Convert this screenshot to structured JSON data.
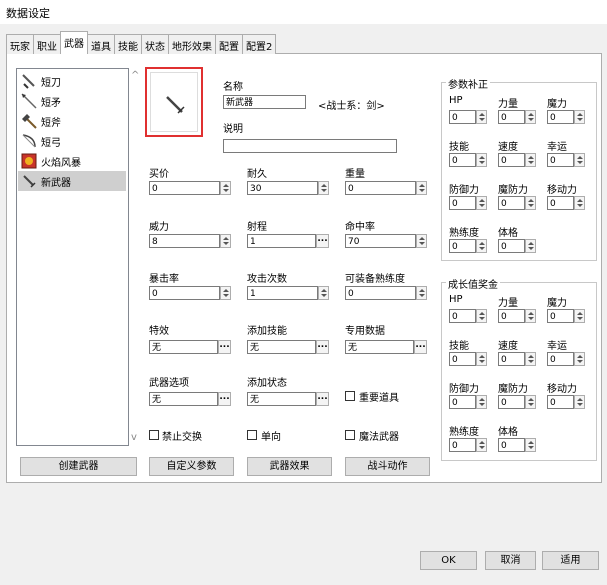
{
  "window": {
    "title": "数据设定"
  },
  "tabs": [
    "玩家",
    "职业",
    "武器",
    "道具",
    "技能",
    "状态",
    "地形效果",
    "配置",
    "配置2"
  ],
  "active_tab": "武器",
  "list": {
    "items": [
      {
        "label": "短刀",
        "icon": "dagger-icon"
      },
      {
        "label": "短矛",
        "icon": "spear-icon"
      },
      {
        "label": "短斧",
        "icon": "axe-icon"
      },
      {
        "label": "短弓",
        "icon": "bow-icon"
      },
      {
        "label": "火焰风暴",
        "icon": "fire-book-icon"
      },
      {
        "label": "新武器",
        "icon": "sword-icon"
      }
    ],
    "selected": "新武器",
    "up_arrow": "^",
    "down_arrow": "v"
  },
  "weapon": {
    "name_label": "名称",
    "name_value": "新武器",
    "class_note": "<战士系：剑>",
    "desc_label": "说明",
    "desc_value": "",
    "price_label": "买价",
    "price_value": "0",
    "durability_label": "耐久",
    "durability_value": "30",
    "weight_label": "重量",
    "weight_value": "0",
    "power_label": "威力",
    "power_value": "8",
    "range_label": "射程",
    "range_value": "1",
    "hit_label": "命中率",
    "hit_value": "70",
    "crit_label": "暴击率",
    "crit_value": "0",
    "attacks_label": "攻击次数",
    "attacks_value": "1",
    "proficiency_label": "可装备熟练度",
    "proficiency_value": "0",
    "special_label": "特效",
    "special_value": "无",
    "addskill_label": "添加技能",
    "addskill_value": "无",
    "custom_label": "专用数据",
    "custom_value": "无",
    "option_label": "武器选项",
    "option_value": "无",
    "addstate_label": "添加状态",
    "addstate_value": "无",
    "important_label": "重要道具",
    "notrade_label": "禁止交换",
    "oneway_label": "单向",
    "magic_label": "魔法武器",
    "dots": "..."
  },
  "bonus": {
    "title": "参数补正",
    "fields": [
      {
        "label": "HP",
        "value": "0"
      },
      {
        "label": "力量",
        "value": "0"
      },
      {
        "label": "魔力",
        "value": "0"
      },
      {
        "label": "技能",
        "value": "0"
      },
      {
        "label": "速度",
        "value": "0"
      },
      {
        "label": "幸运",
        "value": "0"
      },
      {
        "label": "防御力",
        "value": "0"
      },
      {
        "label": "魔防力",
        "value": "0"
      },
      {
        "label": "移动力",
        "value": "0"
      },
      {
        "label": "熟练度",
        "value": "0"
      },
      {
        "label": "体格",
        "value": "0"
      }
    ]
  },
  "growth": {
    "title": "成长值奖金",
    "fields": [
      {
        "label": "HP",
        "value": "0"
      },
      {
        "label": "力量",
        "value": "0"
      },
      {
        "label": "魔力",
        "value": "0"
      },
      {
        "label": "技能",
        "value": "0"
      },
      {
        "label": "速度",
        "value": "0"
      },
      {
        "label": "幸运",
        "value": "0"
      },
      {
        "label": "防御力",
        "value": "0"
      },
      {
        "label": "魔防力",
        "value": "0"
      },
      {
        "label": "移动力",
        "value": "0"
      },
      {
        "label": "熟练度",
        "value": "0"
      },
      {
        "label": "体格",
        "value": "0"
      }
    ]
  },
  "buttons": {
    "create": "创建武器",
    "custom_params": "自定义参数",
    "effect": "武器效果",
    "motion": "战斗动作",
    "ok": "OK",
    "cancel": "取消",
    "apply": "适用"
  }
}
